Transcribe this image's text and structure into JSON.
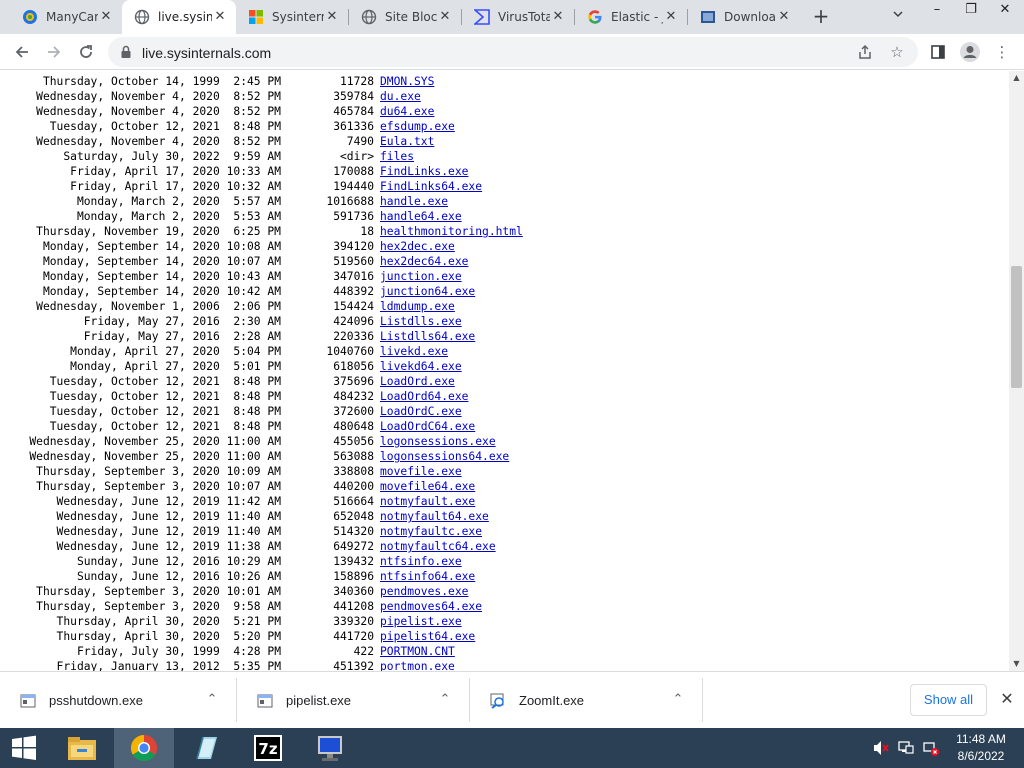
{
  "browser": {
    "tabs": [
      {
        "title": "ManyCam",
        "icon": "manycam-icon",
        "active": false
      },
      {
        "title": "live.sysinternals.com",
        "icon": "globe-icon",
        "active": true
      },
      {
        "title": "Sysinternals",
        "icon": "microsoft-icon",
        "active": false
      },
      {
        "title": "Site Blocked",
        "icon": "globe-icon",
        "active": false
      },
      {
        "title": "VirusTotal",
        "icon": "virustotal-icon",
        "active": false
      },
      {
        "title": "Elastic - Jobs",
        "icon": "google-icon",
        "active": false
      },
      {
        "title": "Downloads",
        "icon": "download-page-icon",
        "active": false
      }
    ],
    "url": "live.sysinternals.com"
  },
  "listing": [
    {
      "date": "Thursday, October 14, 1999  2:45 PM",
      "size": "11728",
      "name": "DMON.SYS"
    },
    {
      "date": "Wednesday, November 4, 2020  8:52 PM",
      "size": "359784",
      "name": "du.exe"
    },
    {
      "date": "Wednesday, November 4, 2020  8:52 PM",
      "size": "465784",
      "name": "du64.exe"
    },
    {
      "date": "Tuesday, October 12, 2021  8:48 PM",
      "size": "361336",
      "name": "efsdump.exe"
    },
    {
      "date": "Wednesday, November 4, 2020  8:52 PM",
      "size": "7490",
      "name": "Eula.txt"
    },
    {
      "date": "Saturday, July 30, 2022  9:59 AM",
      "size": "<dir>",
      "name": "files"
    },
    {
      "date": "Friday, April 17, 2020 10:33 AM",
      "size": "170088",
      "name": "FindLinks.exe"
    },
    {
      "date": "Friday, April 17, 2020 10:32 AM",
      "size": "194440",
      "name": "FindLinks64.exe"
    },
    {
      "date": "Monday, March 2, 2020  5:57 AM",
      "size": "1016688",
      "name": "handle.exe"
    },
    {
      "date": "Monday, March 2, 2020  5:53 AM",
      "size": "591736",
      "name": "handle64.exe"
    },
    {
      "date": "Thursday, November 19, 2020  6:25 PM",
      "size": "18",
      "name": "healthmonitoring.html"
    },
    {
      "date": "Monday, September 14, 2020 10:08 AM",
      "size": "394120",
      "name": "hex2dec.exe"
    },
    {
      "date": "Monday, September 14, 2020 10:07 AM",
      "size": "519560",
      "name": "hex2dec64.exe"
    },
    {
      "date": "Monday, September 14, 2020 10:43 AM",
      "size": "347016",
      "name": "junction.exe"
    },
    {
      "date": "Monday, September 14, 2020 10:42 AM",
      "size": "448392",
      "name": "junction64.exe"
    },
    {
      "date": "Wednesday, November 1, 2006  2:06 PM",
      "size": "154424",
      "name": "ldmdump.exe"
    },
    {
      "date": "Friday, May 27, 2016  2:30 AM",
      "size": "424096",
      "name": "Listdlls.exe"
    },
    {
      "date": "Friday, May 27, 2016  2:28 AM",
      "size": "220336",
      "name": "Listdlls64.exe"
    },
    {
      "date": "Monday, April 27, 2020  5:04 PM",
      "size": "1040760",
      "name": "livekd.exe"
    },
    {
      "date": "Monday, April 27, 2020  5:01 PM",
      "size": "618056",
      "name": "livekd64.exe"
    },
    {
      "date": "Tuesday, October 12, 2021  8:48 PM",
      "size": "375696",
      "name": "LoadOrd.exe"
    },
    {
      "date": "Tuesday, October 12, 2021  8:48 PM",
      "size": "484232",
      "name": "LoadOrd64.exe"
    },
    {
      "date": "Tuesday, October 12, 2021  8:48 PM",
      "size": "372600",
      "name": "LoadOrdC.exe"
    },
    {
      "date": "Tuesday, October 12, 2021  8:48 PM",
      "size": "480648",
      "name": "LoadOrdC64.exe"
    },
    {
      "date": "Wednesday, November 25, 2020 11:00 AM",
      "size": "455056",
      "name": "logonsessions.exe"
    },
    {
      "date": "Wednesday, November 25, 2020 11:00 AM",
      "size": "563088",
      "name": "logonsessions64.exe"
    },
    {
      "date": "Thursday, September 3, 2020 10:09 AM",
      "size": "338808",
      "name": "movefile.exe"
    },
    {
      "date": "Thursday, September 3, 2020 10:07 AM",
      "size": "440200",
      "name": "movefile64.exe"
    },
    {
      "date": "Wednesday, June 12, 2019 11:42 AM",
      "size": "516664",
      "name": "notmyfault.exe"
    },
    {
      "date": "Wednesday, June 12, 2019 11:40 AM",
      "size": "652048",
      "name": "notmyfault64.exe"
    },
    {
      "date": "Wednesday, June 12, 2019 11:40 AM",
      "size": "514320",
      "name": "notmyfaultc.exe"
    },
    {
      "date": "Wednesday, June 12, 2019 11:38 AM",
      "size": "649272",
      "name": "notmyfaultc64.exe"
    },
    {
      "date": "Sunday, June 12, 2016 10:29 AM",
      "size": "139432",
      "name": "ntfsinfo.exe"
    },
    {
      "date": "Sunday, June 12, 2016 10:26 AM",
      "size": "158896",
      "name": "ntfsinfo64.exe"
    },
    {
      "date": "Thursday, September 3, 2020 10:01 AM",
      "size": "340360",
      "name": "pendmoves.exe"
    },
    {
      "date": "Thursday, September 3, 2020  9:58 AM",
      "size": "441208",
      "name": "pendmoves64.exe"
    },
    {
      "date": "Thursday, April 30, 2020  5:21 PM",
      "size": "339320",
      "name": "pipelist.exe"
    },
    {
      "date": "Thursday, April 30, 2020  5:20 PM",
      "size": "441720",
      "name": "pipelist64.exe"
    },
    {
      "date": "Friday, July 30, 1999  4:28 PM",
      "size": "422",
      "name": "PORTMON.CNT"
    },
    {
      "date": "Friday, January 13, 2012  5:35 PM",
      "size": "451392",
      "name": "portmon.exe"
    }
  ],
  "downloads": {
    "items": [
      {
        "name": "psshutdown.exe"
      },
      {
        "name": "pipelist.exe"
      },
      {
        "name": "ZoomIt.exe"
      }
    ],
    "show_all": "Show all"
  },
  "taskbar": {
    "time": "11:48 AM",
    "date": "8/6/2022",
    "apps": [
      "file-explorer-icon",
      "chrome-icon",
      "notepad-icon",
      "7zip-icon",
      "remote-desktop-icon"
    ]
  }
}
